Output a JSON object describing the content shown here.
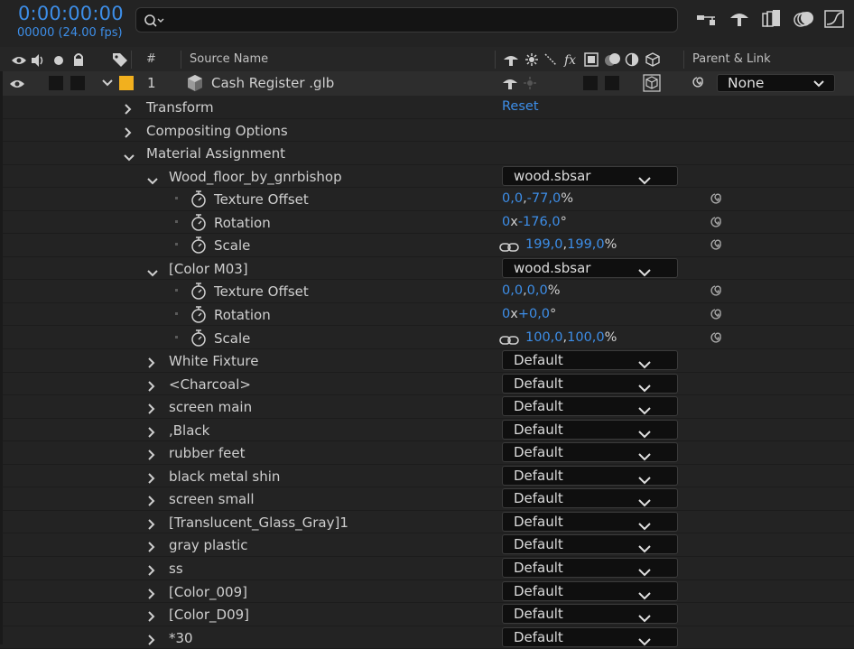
{
  "header": {
    "timecode": "0:00:00:00",
    "fps": "00000 (24.00 fps)",
    "search_placeholder": ""
  },
  "columns": {
    "number": "#",
    "source_name": "Source Name",
    "parent_link": "Parent & Link"
  },
  "layer": {
    "index": "1",
    "name": "Cash Register .glb",
    "parent": "None"
  },
  "groups": {
    "transform": "Transform",
    "transform_reset": "Reset",
    "compositing": "Compositing Options",
    "material_assignment": "Material Assignment"
  },
  "materials_expanded": [
    {
      "name": "Wood_floor_by_gnrbishop",
      "value": "wood.sbsar",
      "texture_offset": {
        "label": "Texture Offset",
        "v1": "0,0",
        "sep": ",",
        "v2": "-77,0",
        "unit": "%"
      },
      "rotation": {
        "label": "Rotation",
        "v1": "0",
        "sep": "x",
        "v2": "-176,0",
        "unit": "°"
      },
      "scale": {
        "label": "Scale",
        "v1": "199,0",
        "sep": ",",
        "v2": "199,0",
        "unit": "%"
      }
    },
    {
      "name": "[Color M03]",
      "value": "wood.sbsar",
      "texture_offset": {
        "label": "Texture Offset",
        "v1": "0,0",
        "sep": ",",
        "v2": "0,0",
        "unit": "%"
      },
      "rotation": {
        "label": "Rotation",
        "v1": "0",
        "sep": "x",
        "v2": "+0,0",
        "unit": "°"
      },
      "scale": {
        "label": "Scale",
        "v1": "100,0",
        "sep": ",",
        "v2": "100,0",
        "unit": "%"
      }
    }
  ],
  "materials_collapsed": [
    {
      "name": "White Fixture",
      "value": "Default"
    },
    {
      "name": "<Charcoal>",
      "value": "Default"
    },
    {
      "name": "screen main",
      "value": "Default"
    },
    {
      "name": ",Black",
      "value": "Default"
    },
    {
      "name": "rubber feet",
      "value": "Default"
    },
    {
      "name": "black metal shin",
      "value": "Default"
    },
    {
      "name": "screen small",
      "value": "Default"
    },
    {
      "name": "[Translucent_Glass_Gray]1",
      "value": "Default"
    },
    {
      "name": "gray plastic",
      "value": "Default"
    },
    {
      "name": "ss",
      "value": "Default"
    },
    {
      "name": "[Color_009]",
      "value": "Default"
    },
    {
      "name": "[Color_D09]",
      "value": "Default"
    },
    {
      "name": "*30",
      "value": "Default"
    }
  ],
  "colors": {
    "accent_blue": "#3d8ee8",
    "label_yellow": "#f2b01e"
  },
  "icons": [
    "search-icon",
    "flowchart-icon",
    "shy-icon",
    "frame-blend-icon",
    "motion-blur-icon",
    "graph-editor-icon",
    "eye-icon",
    "audio-icon",
    "solo-icon",
    "lock-icon",
    "label-icon",
    "cube-icon",
    "stopwatch-icon",
    "pickwhip-icon",
    "link-icon",
    "chevron-down-icon",
    "chevron-right-icon"
  ]
}
